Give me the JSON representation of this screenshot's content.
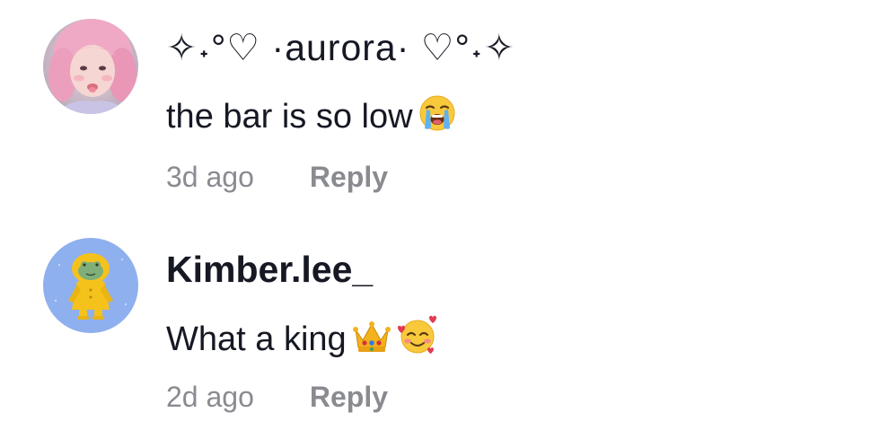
{
  "comments": [
    {
      "username": "✧˖°♡ ·aurora· ♡°˖✧",
      "text": "the bar is so low",
      "emojis": [
        "loudly-crying-face"
      ],
      "time": "3d ago",
      "reply_label": "Reply"
    },
    {
      "username": "Kimber.lee_",
      "text": "What a king",
      "emojis": [
        "crown",
        "smiling-face-with-hearts"
      ],
      "time": "2d ago",
      "reply_label": "Reply"
    }
  ],
  "colors": {
    "background": "#ffffff",
    "text": "#161823",
    "meta": "#8a8b91",
    "avatar2_bg": "#8fb0ee",
    "raincoat": "#f5c21b"
  }
}
